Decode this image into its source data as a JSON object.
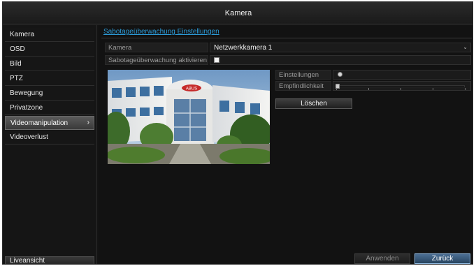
{
  "window": {
    "title": "Kamera"
  },
  "sidebar": {
    "items": [
      {
        "label": "Kamera"
      },
      {
        "label": "OSD"
      },
      {
        "label": "Bild"
      },
      {
        "label": "PTZ"
      },
      {
        "label": "Bewegung"
      },
      {
        "label": "Privatzone"
      },
      {
        "label": "Videomanipulation",
        "active": true
      },
      {
        "label": "Videoverlust"
      }
    ],
    "live_view_label": "Liveansicht"
  },
  "main": {
    "section_title": "Sabotageüberwachung Einstellungen",
    "camera": {
      "label": "Kamera",
      "value": "Netzwerkkamera 1"
    },
    "enable": {
      "label": "Sabotageüberwachung aktivieren",
      "checked": false
    },
    "settings": {
      "label": "Einstellungen",
      "icon": "gear-icon"
    },
    "sensitivity": {
      "label": "Empfindlichkeit",
      "level_fraction": 0.0
    },
    "delete_label": "Löschen",
    "preview_sign": "ABUS"
  },
  "footer": {
    "apply_label": "Anwenden",
    "back_label": "Zurück"
  },
  "colors": {
    "accent": "#2c9bd8",
    "background": "#141414"
  }
}
